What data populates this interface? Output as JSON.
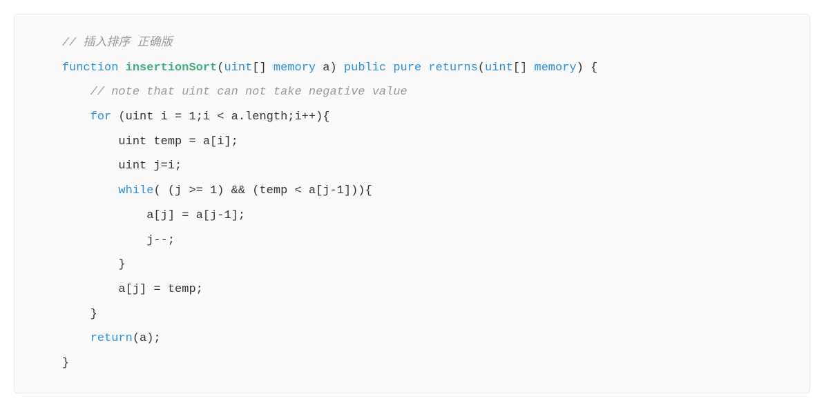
{
  "code": {
    "line1_indent": "    ",
    "line1_comment": "// 插入排序 正确版",
    "line2_indent": "    ",
    "line2_kw_function": "function",
    "line2_space1": " ",
    "line2_fname": "insertionSort",
    "line2_open": "(",
    "line2_type1": "uint",
    "line2_brackets1": "[] ",
    "line2_memory1": "memory",
    "line2_param": " a",
    "line2_close": ") ",
    "line2_public": "public",
    "line2_space2": " ",
    "line2_pure": "pure",
    "line2_space3": " ",
    "line2_returns": "returns",
    "line2_open2": "(",
    "line2_type2": "uint",
    "line2_brackets2": "[] ",
    "line2_memory2": "memory",
    "line2_close2": ") {",
    "line3_indent": "        ",
    "line3_comment": "// note that uint can not take negative value",
    "line4_indent": "        ",
    "line4_for": "for",
    "line4_rest": " (uint i = 1;i < a.length;i++){",
    "line5_indent": "            ",
    "line5_text": "uint temp = a[i];",
    "line6_indent": "            ",
    "line6_text": "uint j=i;",
    "line7_indent": "            ",
    "line7_while": "while",
    "line7_rest": "( (j >= 1) && (temp < a[j-1])){",
    "line8_indent": "                ",
    "line8_text": "a[j] = a[j-1];",
    "line9_indent": "                ",
    "line9_text": "j--;",
    "line10_indent": "            ",
    "line10_text": "}",
    "line11_indent": "            ",
    "line11_text": "a[j] = temp;",
    "line12_indent": "        ",
    "line12_text": "}",
    "line13_indent": "        ",
    "line13_return": "return",
    "line13_rest": "(a);",
    "line14_indent": "    ",
    "line14_text": "}"
  }
}
